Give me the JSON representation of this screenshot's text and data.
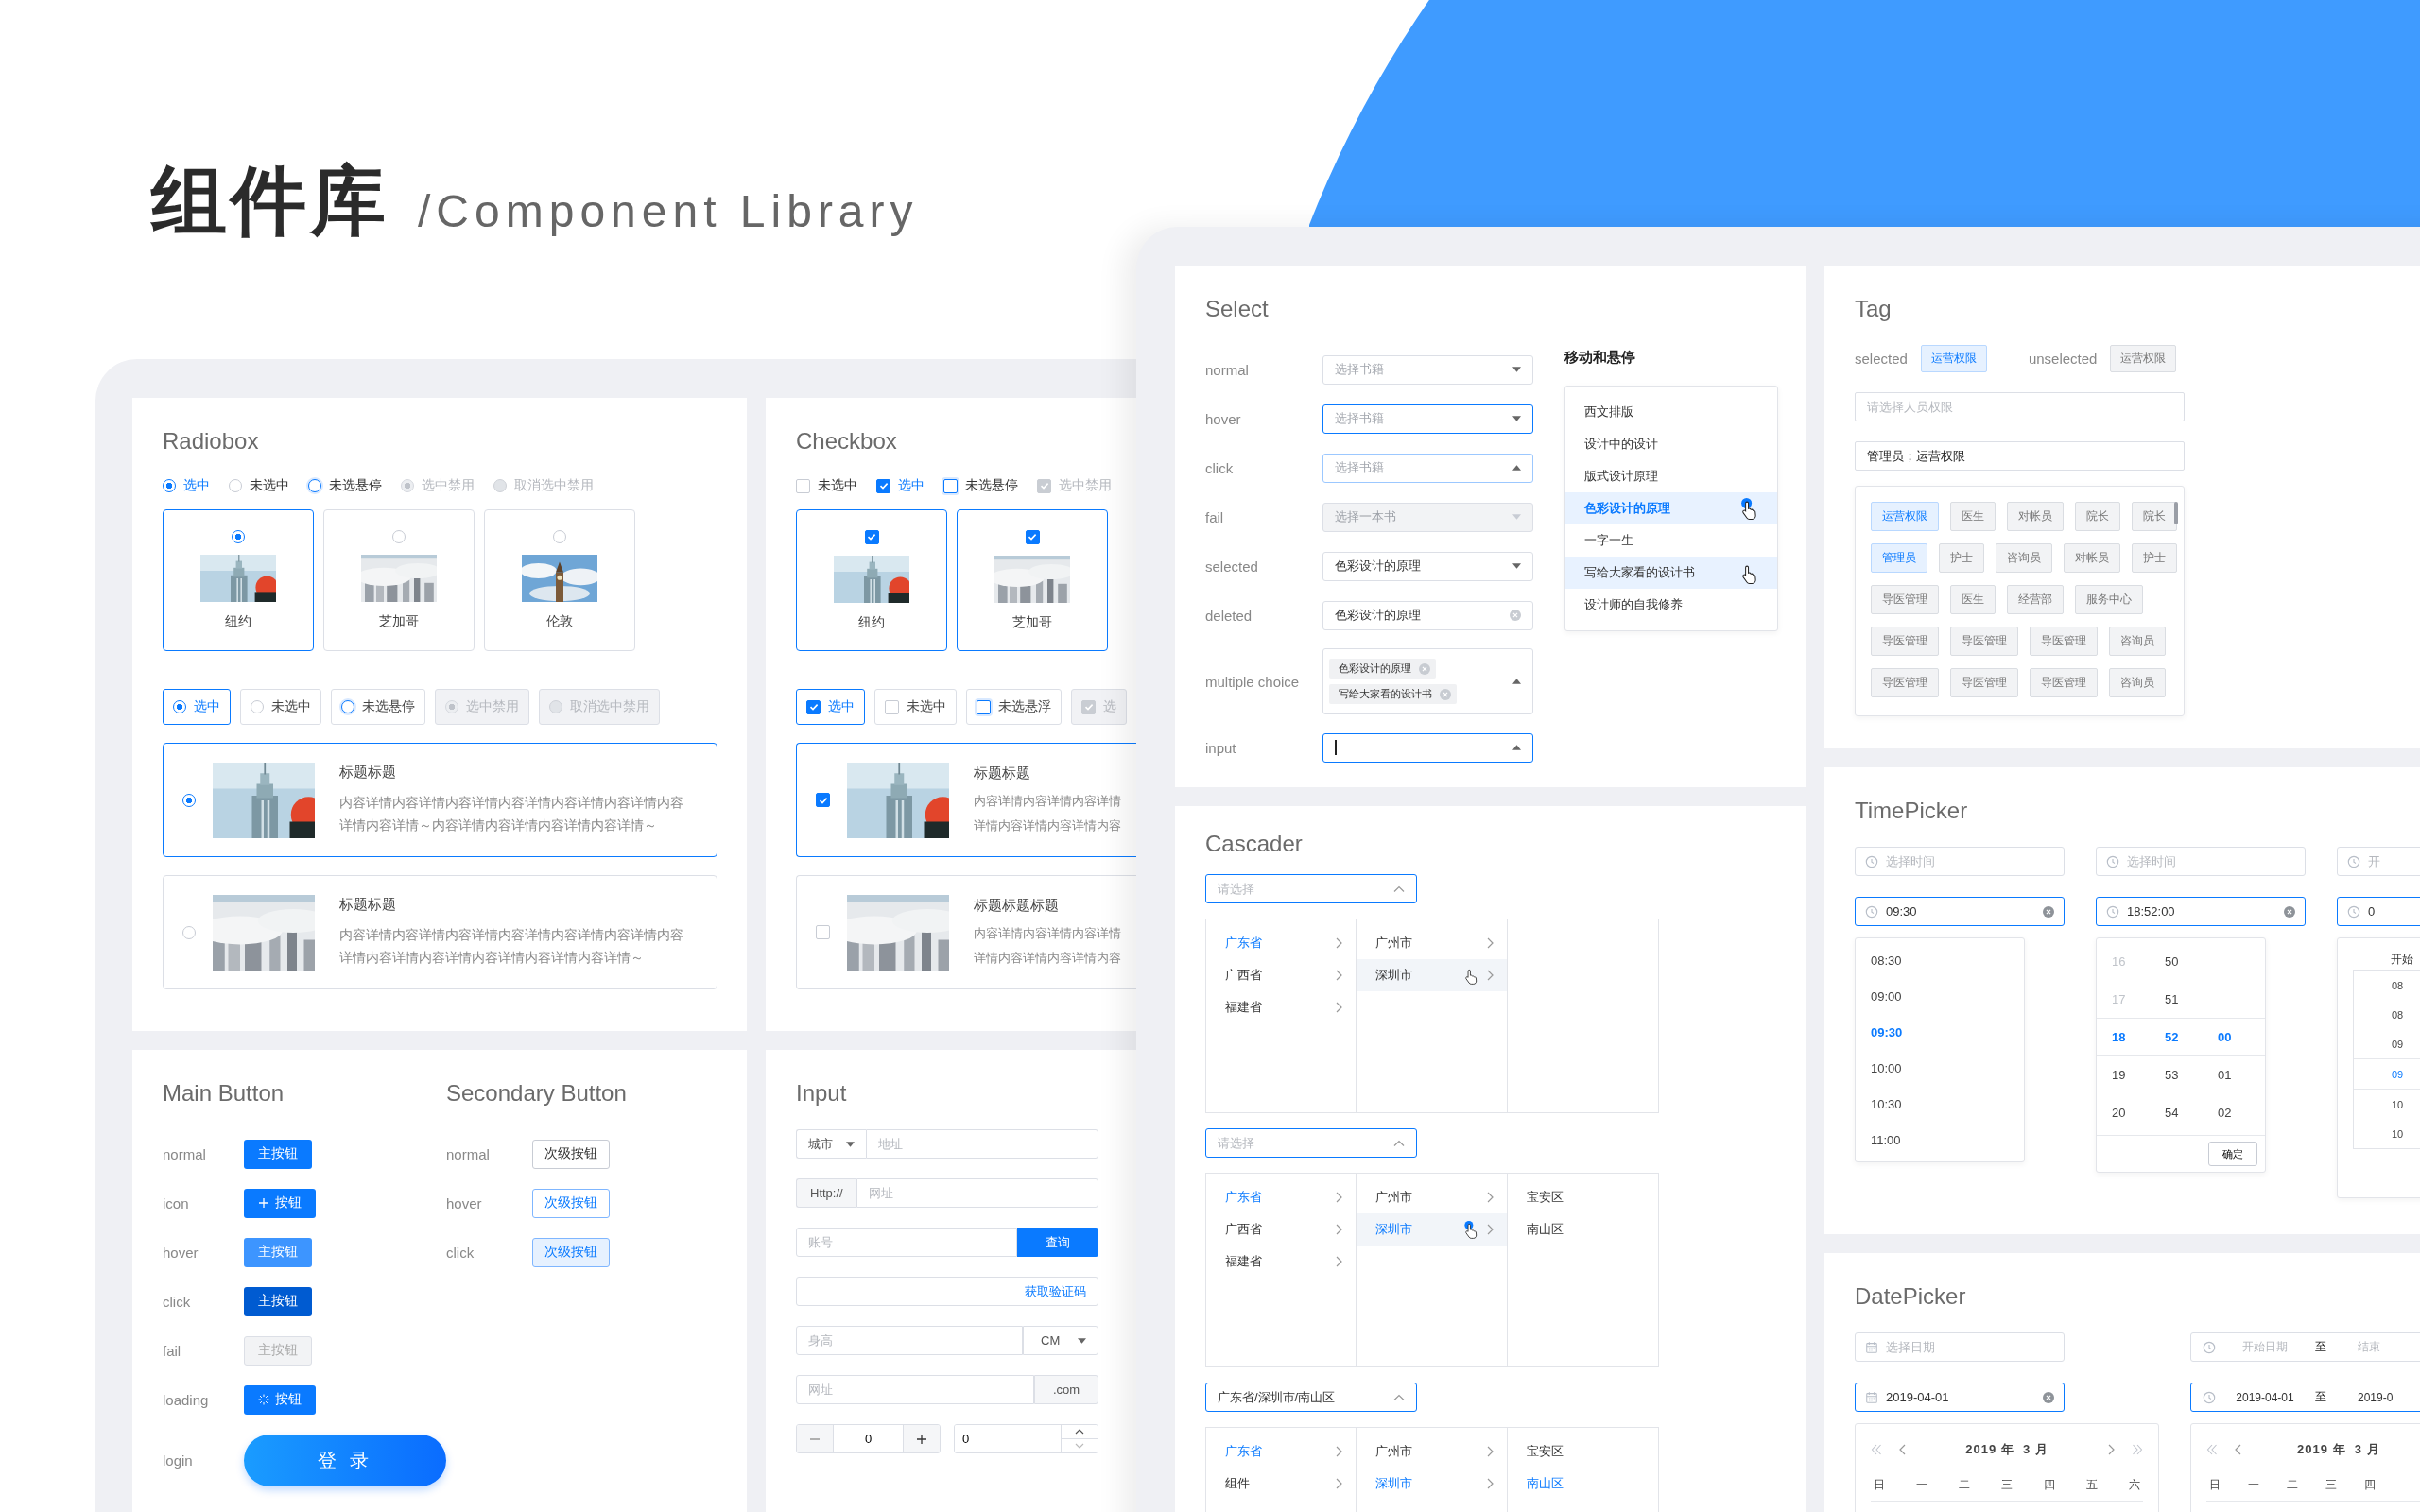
{
  "header": {
    "title": "组件库",
    "subtitle": "/Component Library"
  },
  "radiobox": {
    "title": "Radiobox",
    "options": [
      {
        "label": "选中",
        "kind": "normal",
        "selected": true,
        "disabled": false
      },
      {
        "label": "未选中",
        "kind": "normal",
        "selected": false,
        "disabled": false
      },
      {
        "label": "未选悬停",
        "kind": "hover",
        "selected": false,
        "disabled": false
      },
      {
        "label": "选中禁用",
        "kind": "normal",
        "selected": true,
        "disabled": true
      },
      {
        "label": "取消选中禁用",
        "kind": "normal",
        "selected": false,
        "disabled": true
      }
    ],
    "cards": [
      {
        "label": "纽约",
        "selected": true
      },
      {
        "label": "芝加哥",
        "selected": false
      },
      {
        "label": "伦敦",
        "selected": false
      }
    ],
    "buttons": [
      {
        "label": "选中",
        "kind": "normal",
        "selected": true,
        "disabled": false
      },
      {
        "label": "未选中",
        "kind": "normal",
        "selected": false,
        "disabled": false
      },
      {
        "label": "未选悬停",
        "kind": "hover",
        "selected": false,
        "disabled": false
      },
      {
        "label": "选中禁用",
        "kind": "normal",
        "selected": true,
        "disabled": true
      },
      {
        "label": "取消选中禁用",
        "kind": "normal",
        "selected": false,
        "disabled": true
      }
    ],
    "list": [
      {
        "title": "标题标题",
        "text": "内容详情内容详情内容详情内容详情内容详情内容详情内容详情内容详情～内容详情内容详情内容详情内容详情～",
        "selected": true
      },
      {
        "title": "标题标题",
        "text": "内容详情内容详情内容详情内容详情内容详情内容详情内容详情内容详情内容详情内容详情内容详情内容详情～",
        "selected": false
      }
    ]
  },
  "checkbox": {
    "title": "Checkbox",
    "options": [
      {
        "label": "未选中",
        "kind": "normal",
        "checked": false,
        "disabled": false
      },
      {
        "label": "选中",
        "kind": "normal",
        "checked": true,
        "disabled": false
      },
      {
        "label": "未选悬停",
        "kind": "hover",
        "checked": false,
        "disabled": false
      },
      {
        "label": "选中禁用",
        "kind": "normal",
        "checked": true,
        "disabled": true
      }
    ],
    "cards": [
      {
        "label": "纽约",
        "checked": true
      },
      {
        "label": "芝加哥",
        "checked": true
      }
    ],
    "buttons": [
      {
        "label": "选中",
        "kind": "normal",
        "checked": true,
        "disabled": false
      },
      {
        "label": "未选中",
        "kind": "normal",
        "checked": false,
        "disabled": false
      },
      {
        "label": "未选悬浮",
        "kind": "hover",
        "checked": false,
        "disabled": false
      },
      {
        "label": "选",
        "kind": "normal",
        "checked": true,
        "disabled": true
      }
    ],
    "list": [
      {
        "title": "标题标题",
        "lines": [
          "内容详情内容详情内容详情",
          "详情内容详情内容详情内容"
        ],
        "checked": true
      },
      {
        "title": "标题标题标题",
        "lines": [
          "内容详情内容详情内容详情",
          "详情内容详情内容详情内容"
        ],
        "checked": false
      }
    ]
  },
  "main_button": {
    "title": "Main Button",
    "rows": [
      {
        "label": "normal",
        "kind": "normal",
        "text": "主按钮"
      },
      {
        "label": "icon",
        "kind": "icon",
        "text": "按钮"
      },
      {
        "label": "hover",
        "kind": "hover",
        "text": "主按钮"
      },
      {
        "label": "click",
        "kind": "click",
        "text": "主按钮"
      },
      {
        "label": "fail",
        "kind": "fail",
        "text": "主按钮"
      },
      {
        "label": "loading",
        "kind": "loading",
        "text": "按钮"
      },
      {
        "label": "login",
        "kind": "login",
        "text": "登 录"
      }
    ]
  },
  "secondary_button": {
    "title": "Secondary Button",
    "rows": [
      {
        "label": "normal",
        "kind": "normal",
        "text": "次级按钮"
      },
      {
        "label": "hover",
        "kind": "hover",
        "text": "次级按钮"
      },
      {
        "label": "click",
        "kind": "click",
        "text": "次级按钮"
      }
    ]
  },
  "input": {
    "title": "Input",
    "rows": [
      {
        "kind": "select-prefix",
        "prefix": "城市",
        "placeholder": "地址"
      },
      {
        "kind": "addon-prefix",
        "prefix": "Http://",
        "placeholder": "网址"
      },
      {
        "kind": "button-suffix",
        "placeholder": "账号",
        "suffix": "查询"
      },
      {
        "kind": "link-suffix",
        "suffix": "获取验证码"
      },
      {
        "kind": "select-suffix",
        "placeholder": "身高",
        "suffix": "CM"
      },
      {
        "kind": "addon-suffix",
        "placeholder": "网址",
        "suffix": ".com"
      },
      {
        "kind": "number",
        "value": "0",
        "value2": "0"
      }
    ]
  },
  "select": {
    "title": "Select",
    "rows": [
      {
        "label": "normal",
        "kind": "normal",
        "placeholder": "选择书籍"
      },
      {
        "label": "hover",
        "kind": "hover",
        "placeholder": "选择书籍"
      },
      {
        "label": "click",
        "kind": "click",
        "placeholder": "选择书籍"
      },
      {
        "label": "fail",
        "kind": "fail",
        "placeholder": "选择一本书"
      },
      {
        "label": "selected",
        "kind": "selected",
        "value": "色彩设计的原理"
      },
      {
        "label": "deleted",
        "kind": "deleted",
        "value": "色彩设计的原理"
      },
      {
        "label": "multiple choice",
        "kind": "multiple",
        "tags": [
          "色彩设计的原理",
          "写给大家看的设计书"
        ]
      },
      {
        "label": "input",
        "kind": "input"
      }
    ],
    "dropdown": {
      "title": "移动和悬停",
      "items": [
        {
          "text": "西文排版",
          "selected": false,
          "hover": false,
          "pressed": false
        },
        {
          "text": "设计中的设计",
          "selected": false,
          "hover": false,
          "pressed": false
        },
        {
          "text": "版式设计原理",
          "selected": false,
          "hover": false,
          "pressed": false
        },
        {
          "text": "色彩设计的原理",
          "selected": true,
          "hover": false,
          "pressed": true
        },
        {
          "text": "一字一生",
          "selected": false,
          "hover": false,
          "pressed": false
        },
        {
          "text": "写给大家看的设计书",
          "selected": false,
          "hover": true,
          "pressed": false
        },
        {
          "text": "设计师的自我修养",
          "selected": false,
          "hover": false,
          "pressed": false
        }
      ]
    }
  },
  "cascader": {
    "title": "Cascader",
    "instances": [
      {
        "placeholder": "请选择",
        "columns": [
          {
            "items": [
              {
                "text": "广东省",
                "selected": true,
                "hover": false,
                "pressed": false,
                "expandable": true
              },
              {
                "text": "广西省",
                "selected": false,
                "hover": false,
                "pressed": false,
                "expandable": true
              },
              {
                "text": "福建省",
                "selected": false,
                "hover": false,
                "pressed": false,
                "expandable": true
              }
            ]
          },
          {
            "items": [
              {
                "text": "广州市",
                "selected": false,
                "hover": false,
                "pressed": false,
                "expandable": true
              },
              {
                "text": "深圳市",
                "selected": false,
                "hover": true,
                "pressed": false,
                "expandable": true
              }
            ]
          }
        ]
      },
      {
        "placeholder": "请选择",
        "columns": [
          {
            "items": [
              {
                "text": "广东省",
                "selected": true,
                "hover": false,
                "pressed": false,
                "expandable": true
              },
              {
                "text": "广西省",
                "selected": false,
                "hover": false,
                "pressed": false,
                "expandable": true
              },
              {
                "text": "福建省",
                "selected": false,
                "hover": false,
                "pressed": false,
                "expandable": true
              }
            ]
          },
          {
            "items": [
              {
                "text": "广州市",
                "selected": false,
                "hover": false,
                "pressed": false,
                "expandable": true
              },
              {
                "text": "深圳市",
                "selected": true,
                "hover": true,
                "pressed": true,
                "expandable": true
              }
            ]
          },
          {
            "items": [
              {
                "text": "宝安区",
                "selected": false,
                "hover": false,
                "pressed": false,
                "expandable": false
              },
              {
                "text": "南山区",
                "selected": false,
                "hover": false,
                "pressed": false,
                "expandable": false
              }
            ]
          }
        ]
      },
      {
        "value": "广东省/深圳市/南山区",
        "columns": [
          {
            "items": [
              {
                "text": "广东省",
                "selected": true,
                "hover": false,
                "pressed": false,
                "expandable": true
              },
              {
                "text": "组件",
                "selected": false,
                "hover": false,
                "pressed": false,
                "expandable": true
              }
            ]
          },
          {
            "items": [
              {
                "text": "广州市",
                "selected": false,
                "hover": false,
                "pressed": false,
                "expandable": true
              },
              {
                "text": "深圳市",
                "selected": true,
                "hover": false,
                "pressed": false,
                "expandable": true
              }
            ]
          },
          {
            "items": [
              {
                "text": "宝安区",
                "selected": false,
                "hover": false,
                "pressed": false,
                "expandable": false
              },
              {
                "text": "南山区",
                "selected": true,
                "hover": false,
                "pressed": false,
                "expandable": false
              }
            ]
          }
        ]
      }
    ]
  },
  "tag": {
    "title": "Tag",
    "samples": [
      {
        "label": "selected",
        "tag": "运营权限",
        "selected": true
      },
      {
        "label": "unselected",
        "tag": "运营权限",
        "selected": false
      }
    ],
    "field": {
      "placeholder": "请选择人员权限"
    },
    "picker": {
      "value": "管理员；运营权限"
    },
    "option_rows": [
      {
        "tags": [
          {
            "text": "运营权限",
            "selected": true
          },
          {
            "text": "医生",
            "selected": false
          },
          {
            "text": "对帐员",
            "selected": false
          },
          {
            "text": "院长",
            "selected": false
          },
          {
            "text": "院长",
            "selected": false
          }
        ]
      },
      {
        "tags": [
          {
            "text": "管理员",
            "selected": true
          },
          {
            "text": "护士",
            "selected": false
          },
          {
            "text": "咨询员",
            "selected": false
          },
          {
            "text": "对帐员",
            "selected": false
          },
          {
            "text": "护士",
            "selected": false
          }
        ]
      },
      {
        "tags": [
          {
            "text": "导医管理",
            "selected": false
          },
          {
            "text": "医生",
            "selected": false
          },
          {
            "text": "经营部",
            "selected": false
          },
          {
            "text": "服务中心",
            "selected": false
          }
        ]
      },
      {
        "tags": [
          {
            "text": "导医管理",
            "selected": false
          },
          {
            "text": "导医管理",
            "selected": false
          },
          {
            "text": "导医管理",
            "selected": false
          },
          {
            "text": "咨询员",
            "selected": false
          }
        ]
      },
      {
        "tags": [
          {
            "text": "导医管理",
            "selected": false
          },
          {
            "text": "导医管理",
            "selected": false
          },
          {
            "text": "导医管理",
            "selected": false
          },
          {
            "text": "咨询员",
            "selected": false
          }
        ]
      }
    ]
  },
  "timepicker": {
    "title": "TimePicker",
    "pickers": [
      {
        "kind": "list",
        "placeholder": "选择时间",
        "value": "09:30",
        "items": [
          {
            "text": "08:30",
            "selected": false
          },
          {
            "text": "09:00",
            "selected": false
          },
          {
            "text": "09:30",
            "selected": true
          },
          {
            "text": "10:00",
            "selected": false
          },
          {
            "text": "10:30",
            "selected": false
          },
          {
            "text": "11:00",
            "selected": false
          }
        ]
      },
      {
        "kind": "columns",
        "placeholder": "选择时间",
        "value": "18:52:00",
        "confirm": "确定",
        "rows": [
          {
            "selected": false,
            "cells": [
              {
                "text": "16",
                "disabled": true
              },
              {
                "text": "50",
                "disabled": false
              }
            ]
          },
          {
            "selected": false,
            "cells": [
              {
                "text": "17",
                "disabled": true
              },
              {
                "text": "51",
                "disabled": false
              }
            ]
          },
          {
            "selected": true,
            "cells": [
              {
                "text": "18",
                "disabled": false
              },
              {
                "text": "52",
                "disabled": false
              },
              {
                "text": "00",
                "disabled": false
              }
            ]
          },
          {
            "selected": false,
            "cells": [
              {
                "text": "19",
                "disabled": false
              },
              {
                "text": "53",
                "disabled": false
              },
              {
                "text": "01",
                "disabled": false
              }
            ]
          },
          {
            "selected": false,
            "cells": [
              {
                "text": "20",
                "disabled": false
              },
              {
                "text": "54",
                "disabled": false
              },
              {
                "text": "02",
                "disabled": false
              }
            ]
          }
        ]
      },
      {
        "kind": "range",
        "placeholder": "开",
        "value": "0",
        "heading": "开始",
        "items": [
          {
            "text": "08",
            "selected": false
          },
          {
            "text": "08",
            "selected": false
          },
          {
            "text": "09",
            "selected": false
          },
          {
            "text": "09",
            "selected": true
          },
          {
            "text": "10",
            "selected": false
          },
          {
            "text": "10",
            "selected": false
          }
        ]
      }
    ]
  },
  "datepicker": {
    "title": "DatePicker",
    "pickers": [
      {
        "kind": "single",
        "placeholder": "选择日期",
        "value": "2019-04-01",
        "month": "2019 年  3 月",
        "weekdays": [
          "日",
          "一",
          "二",
          "三",
          "四",
          "五",
          "六"
        ]
      },
      {
        "kind": "range",
        "placeholder_start": "开始日期",
        "separator": "至",
        "value_separator": "至",
        "placeholder_end": "结束",
        "value_start": "2019-04-01",
        "value_end": "2019-0",
        "month": "2019 年  3 月",
        "weekdays": [
          "日",
          "一",
          "二",
          "三",
          "四"
        ]
      }
    ]
  }
}
